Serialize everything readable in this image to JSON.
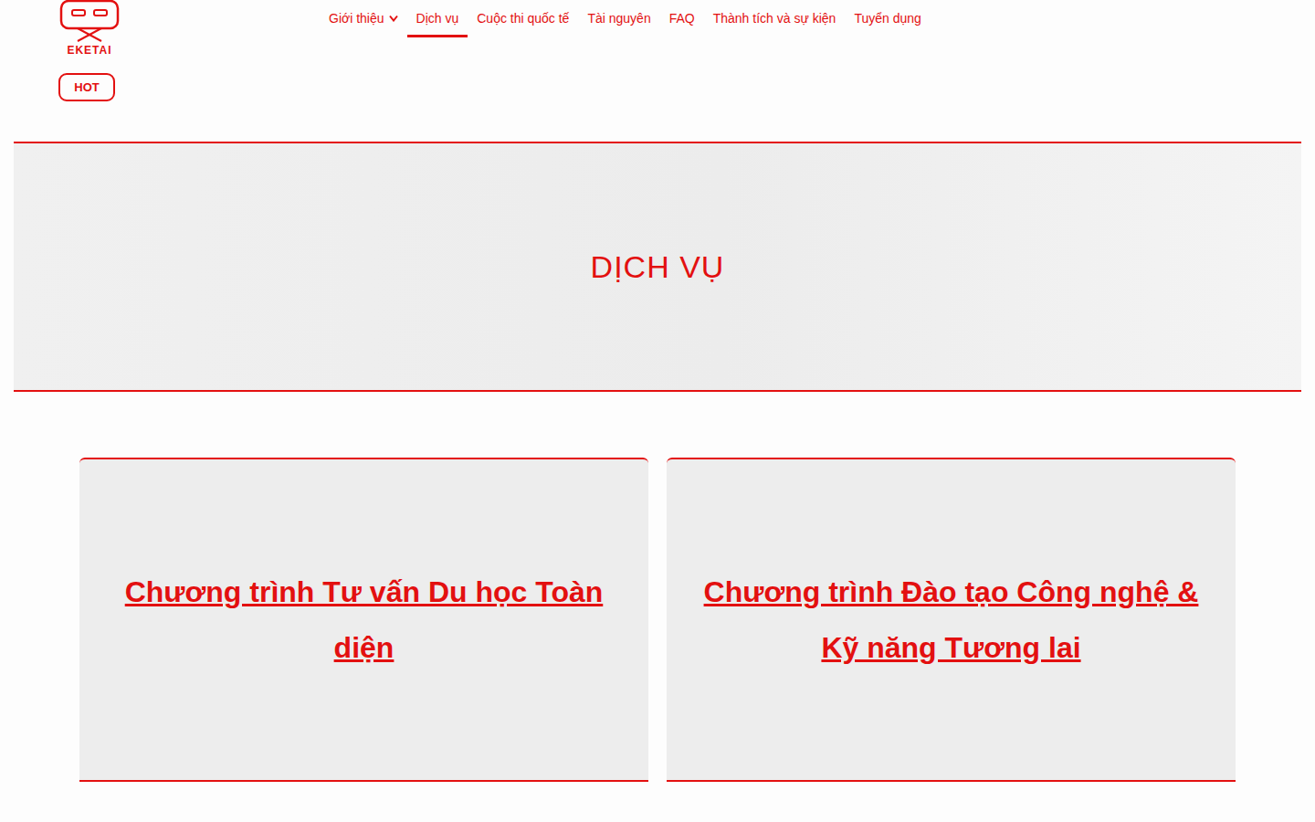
{
  "logo": {
    "text": "EKETAI",
    "badge": "HOT"
  },
  "nav": [
    {
      "label": "Giới thiệu",
      "selected": false,
      "dropdown": true
    },
    {
      "label": "Dịch vụ",
      "selected": true,
      "dropdown": false
    },
    {
      "label": "Cuộc thi quốc tế",
      "selected": false,
      "dropdown": false
    },
    {
      "label": "Tài nguyên",
      "selected": false,
      "dropdown": false
    },
    {
      "label": "FAQ",
      "selected": false,
      "dropdown": false
    },
    {
      "label": "Thành tích và sự kiện",
      "selected": false,
      "dropdown": false
    },
    {
      "label": "Tuyển dụng",
      "selected": false,
      "dropdown": false
    }
  ],
  "hero": {
    "title": "DỊCH VỤ"
  },
  "cards": [
    {
      "title": "Chương trình Tư vấn Du học Toàn diện"
    },
    {
      "title": "Chương trình Đào tạo Công nghệ & Kỹ năng Tương lai"
    }
  ]
}
